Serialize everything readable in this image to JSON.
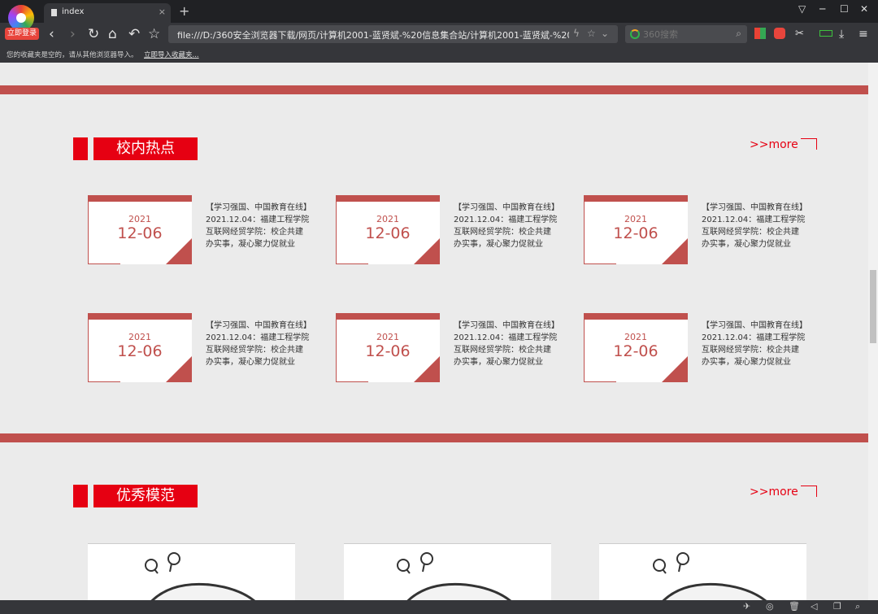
{
  "browser": {
    "login_label": "立即登录",
    "tab_title": "index",
    "tab_close": "×",
    "new_tab": "+",
    "url": "file:///D:/360安全浏览器下载/网页/计算机2001-蓝贤斌-%20信息集合站/计算机2001-蓝贤斌-%20信息集合",
    "search_placeholder": "360搜索",
    "bookmark_message": "您的收藏夹是空的，请从其他浏览器导入。",
    "bookmark_import": "立即导入收藏夹...",
    "window_controls": [
      "▽",
      "─",
      "☐",
      "✕"
    ]
  },
  "sections": [
    {
      "title": "校内热点",
      "more": ">>more",
      "items": [
        {
          "year": "2021",
          "day": "12-06",
          "text": "【学习强国、中国教育在线】2021.12.04：福建工程学院互联网经贸学院：校企共建办实事，凝心聚力促就业"
        },
        {
          "year": "2021",
          "day": "12-06",
          "text": "【学习强国、中国教育在线】2021.12.04：福建工程学院互联网经贸学院：校企共建办实事，凝心聚力促就业"
        },
        {
          "year": "2021",
          "day": "12-06",
          "text": "【学习强国、中国教育在线】2021.12.04：福建工程学院互联网经贸学院：校企共建办实事，凝心聚力促就业"
        },
        {
          "year": "2021",
          "day": "12-06",
          "text": "【学习强国、中国教育在线】2021.12.04：福建工程学院互联网经贸学院：校企共建办实事，凝心聚力促就业"
        },
        {
          "year": "2021",
          "day": "12-06",
          "text": "【学习强国、中国教育在线】2021.12.04：福建工程学院互联网经贸学院：校企共建办实事，凝心聚力促就业"
        },
        {
          "year": "2021",
          "day": "12-06",
          "text": "【学习强国、中国教育在线】2021.12.04：福建工程学院互联网经贸学院：校企共建办实事，凝心聚力促就业"
        }
      ]
    },
    {
      "title": "优秀模范",
      "more": ">>more"
    }
  ],
  "colors": {
    "accent_red": "#e60012",
    "muted_red": "#c0504d",
    "background": "#ebebeb"
  }
}
